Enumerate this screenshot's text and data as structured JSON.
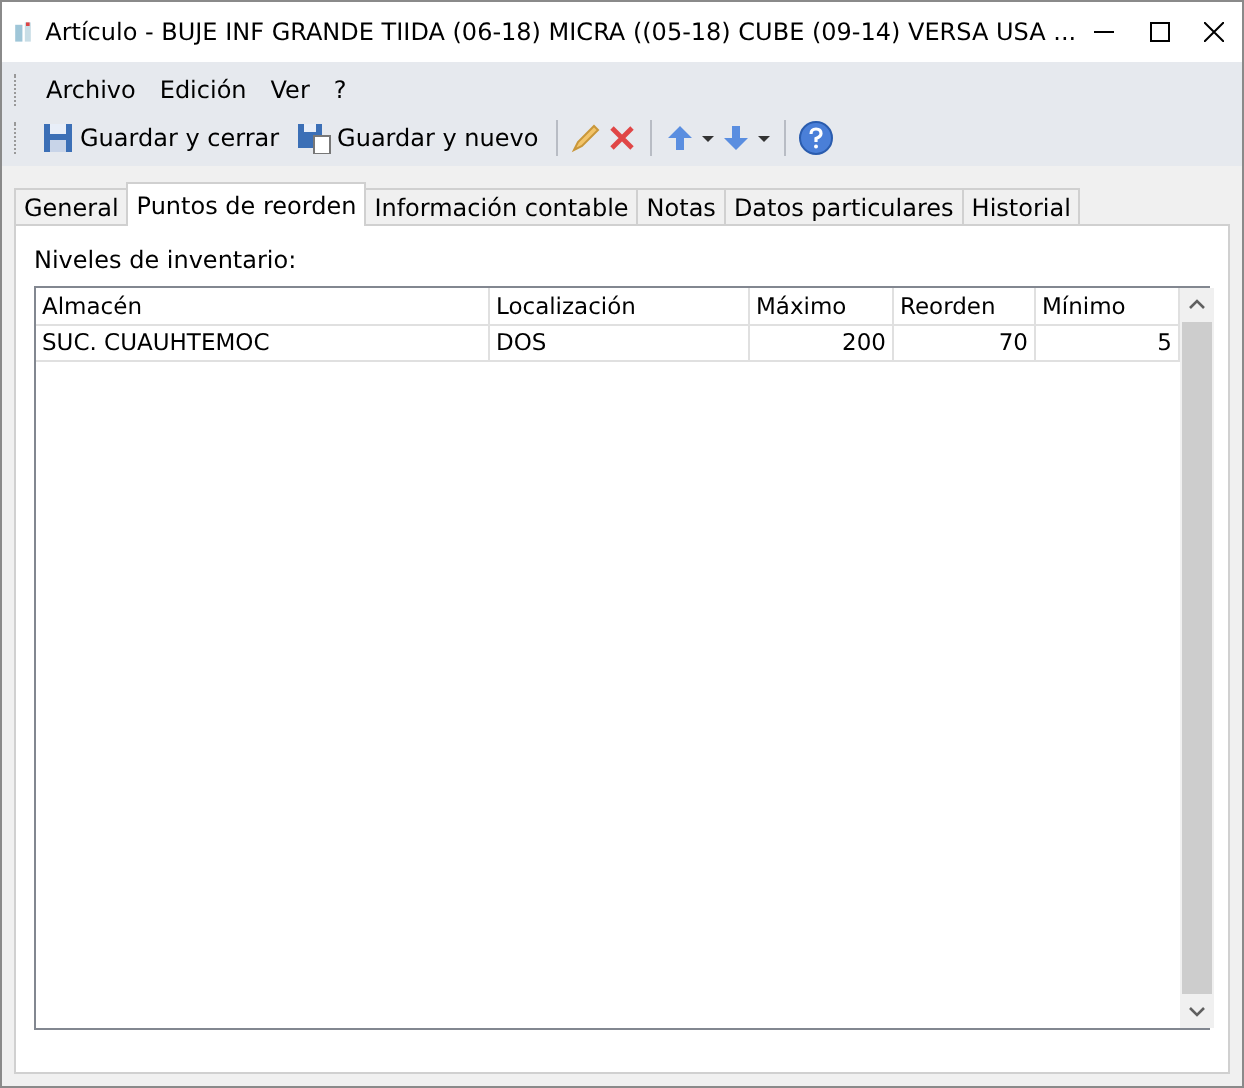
{
  "window": {
    "title": "Artículo - BUJE INF GRANDE TIIDA (06-18) MICRA ((05-18) CUBE (09-14) VERSA USA ..."
  },
  "menu": [
    "Archivo",
    "Edición",
    "Ver",
    "?"
  ],
  "toolbar": [
    {
      "kind": "save",
      "label": "Guardar y cerrar"
    },
    {
      "kind": "savenew",
      "label": "Guardar y nuevo"
    },
    {
      "kind": "sep"
    },
    {
      "kind": "edit"
    },
    {
      "kind": "delete"
    },
    {
      "kind": "sep"
    },
    {
      "kind": "up"
    },
    {
      "kind": "down"
    },
    {
      "kind": "sep"
    },
    {
      "kind": "help"
    }
  ],
  "tabs": [
    {
      "label": "General",
      "selected": false
    },
    {
      "label": "Puntos de reorden",
      "selected": true
    },
    {
      "label": "Información contable",
      "selected": false
    },
    {
      "label": "Notas",
      "selected": false
    },
    {
      "label": "Datos particulares",
      "selected": false
    },
    {
      "label": "Historial",
      "selected": false
    }
  ],
  "section_label": "Niveles de inventario:",
  "table": {
    "columns": [
      "Almacén",
      "Localización",
      "Máximo",
      "Reorden",
      "Mínimo"
    ],
    "rows": [
      [
        "SUC. CUAUHTEMOC",
        "DOS",
        "200",
        "70",
        "5"
      ]
    ]
  }
}
